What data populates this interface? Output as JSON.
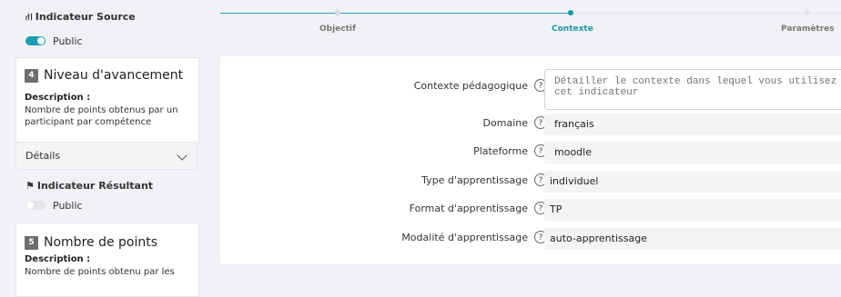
{
  "sidebar": {
    "source_header": "Indicateur Source",
    "source_icon": "sitemap-icon",
    "source_toggle_label": "Public",
    "source_toggle_on": true,
    "card1": {
      "number": "4",
      "title": "Niveau d'avancement",
      "desc_label": "Description :",
      "desc_text": "Nombre de points obtenus par un participant par compétence"
    },
    "details_label": "Détails",
    "result_header": "Indicateur Résultant",
    "result_icon": "flag-icon",
    "result_toggle_label": "Public",
    "result_toggle_on": false,
    "card2": {
      "number": "5",
      "title": "Nombre de points",
      "desc_label": "Description :",
      "desc_text": "Nombre de points obtenu par les"
    }
  },
  "stepper": {
    "steps": [
      {
        "label": "Objectif",
        "state": "done"
      },
      {
        "label": "Contexte",
        "state": "active"
      },
      {
        "label": "Paramètres",
        "state": "todo"
      }
    ]
  },
  "form": {
    "help_glyph": "?",
    "contexte": {
      "label": "Contexte pédagogique",
      "placeholder": "Détailler le contexte dans lequel vous utilisez cet indicateur",
      "value": ""
    },
    "domaine": {
      "label": "Domaine",
      "value": "français"
    },
    "plateforme": {
      "label": "Plateforme",
      "value": "moodle"
    },
    "type": {
      "label": "Type d'apprentissage",
      "value": "individuel"
    },
    "format": {
      "label": "Format d'apprentissage",
      "value": "TP"
    },
    "modalite": {
      "label": "Modalité d'apprentissage",
      "value": "auto-apprentissage"
    }
  },
  "colors": {
    "accent": "#1f95a8",
    "toggle_on": "#1a9cb0"
  }
}
